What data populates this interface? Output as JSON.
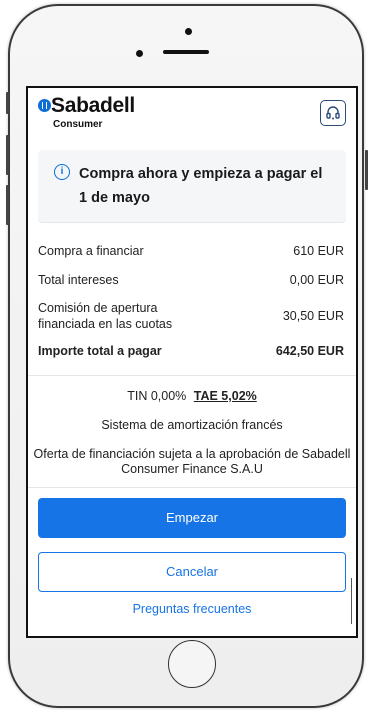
{
  "brand": {
    "name": "Sabadell",
    "sub": "Consumer"
  },
  "header": {
    "support_icon": "headset-icon"
  },
  "banner": {
    "icon": "info-icon",
    "text": "Compra ahora y empieza a pagar el 1 de mayo"
  },
  "summary": {
    "rows": [
      {
        "label": "Compra a financiar",
        "value": "610 EUR"
      },
      {
        "label": "Total intereses",
        "value": "0,00 EUR"
      },
      {
        "label": "Comisión de apertura financiada en las cuotas",
        "value": "30,50 EUR"
      }
    ],
    "total": {
      "label": "Importe total a pagar",
      "value": "642,50 EUR"
    }
  },
  "rates": {
    "tin": "TIN 0,00%",
    "tae": "TAE 5,02%"
  },
  "method": "Sistema de amortización francés",
  "offer": "Oferta de financiación sujeta a la aprobación de Sabadell Consumer Finance S.A.U",
  "actions": {
    "start": "Empezar",
    "cancel": "Cancelar",
    "faq": "Preguntas frecuentes"
  },
  "colors": {
    "primary": "#1774e6",
    "brand": "#0b6fd6"
  }
}
